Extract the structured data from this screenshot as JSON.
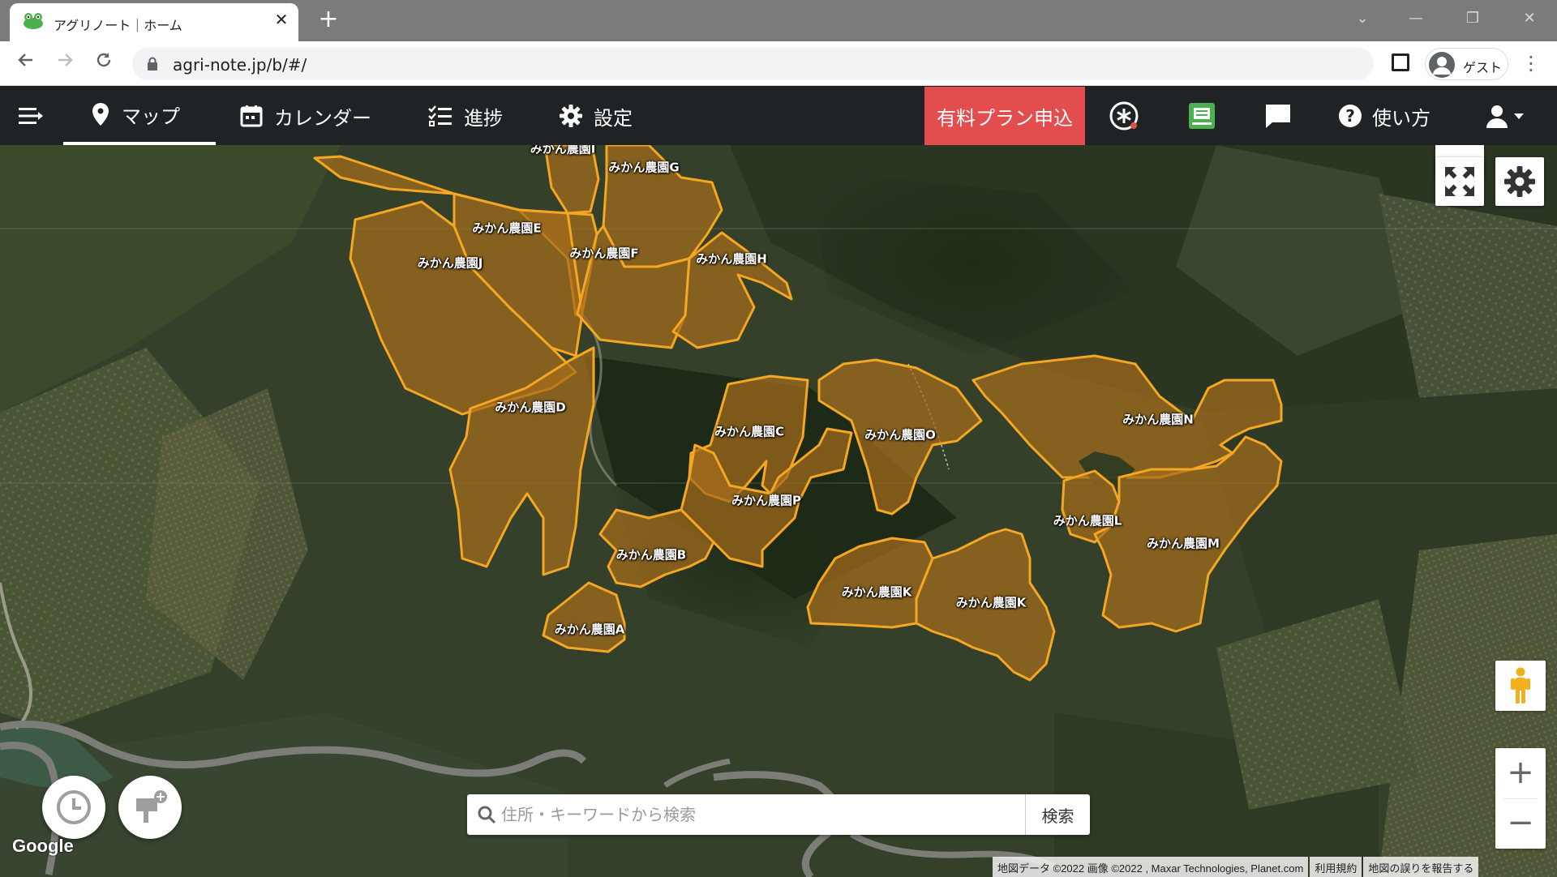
{
  "browser": {
    "tab_title": "アグリノート｜ホーム",
    "url": "agri-note.jp/b/#/",
    "profile_label": "ゲスト"
  },
  "header": {
    "nav": [
      {
        "label": "マップ",
        "icon": "map-pin-icon",
        "active": true
      },
      {
        "label": "カレンダー",
        "icon": "calendar-icon"
      },
      {
        "label": "進捗",
        "icon": "checklist-icon"
      },
      {
        "label": "設定",
        "icon": "gear-icon"
      }
    ],
    "plan_button": "有料プラン申込",
    "help_label": "使い方",
    "accent_color": "#e44d4d"
  },
  "map": {
    "fields": [
      {
        "label": "みかん農園I"
      },
      {
        "label": "みかん農園G"
      },
      {
        "label": "みかん農園E"
      },
      {
        "label": "みかん農園J"
      },
      {
        "label": "みかん農園F"
      },
      {
        "label": "みかん農園H"
      },
      {
        "label": "みかん農園D"
      },
      {
        "label": "みかん農園C"
      },
      {
        "label": "みかん農園O"
      },
      {
        "label": "みかん農園N"
      },
      {
        "label": "みかん農園P"
      },
      {
        "label": "みかん農園L"
      },
      {
        "label": "みかん農園M"
      },
      {
        "label": "みかん農園B"
      },
      {
        "label": "みかん農園K"
      },
      {
        "label": "みかん農園K"
      },
      {
        "label": "みかん農園A"
      }
    ],
    "field_fill": "#a56c1c",
    "field_stroke": "#f5a623",
    "search_placeholder": "住所・キーワードから検索",
    "search_button": "検索",
    "zoom_in": "+",
    "zoom_out": "−",
    "google_logo": "Google",
    "attribution": [
      "地図データ ©2022 画像 ©2022 , Maxar Technologies, Planet.com",
      "利用規約",
      "地図の誤りを報告する"
    ]
  }
}
